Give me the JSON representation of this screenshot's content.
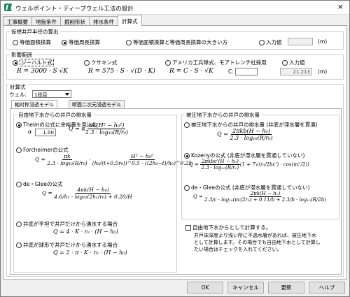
{
  "window": {
    "title": "ウェルポイント・ディープウェル工法の設計",
    "close": "×"
  },
  "tabs": [
    "工事概要",
    "地盤条件",
    "掘削形状",
    "排水条件",
    "計算式"
  ],
  "radius": {
    "title": "仮想井戸半径の算出",
    "opt1": "等価面積換算",
    "opt2": "等価周長換算",
    "opt3": "等価面積換算と等価周長換算の大きい方",
    "opt4": "入力値",
    "unit": "(m)"
  },
  "influence": {
    "title": "影響範囲",
    "opt1": "ジーハルト式",
    "opt2": "クサキン式",
    "opt3": "アメリカ工兵隊式、モアトレンチ社採用",
    "opt4": "入力値",
    "f1": "R = 3000 · S √K",
    "f2": "R = 575 · S · √(D · K)",
    "f3": "R = C · S · √K",
    "c_label": "C:",
    "value": "21.213",
    "unit": "(m)"
  },
  "calc": {
    "title": "計算式",
    "well_label": "ウェル:",
    "well_value": "1段目",
    "sub1": "軸対称浸透モデル",
    "sub2": "断面二次元浸透モデル"
  },
  "free": {
    "title": "自由地下水からの井戸の排水量",
    "thiem": "Theimの公式に余裕量を見込む",
    "alpha": "α",
    "alpha_val": "1.00",
    "forch": "Forcheimerの公式",
    "degl": "de・Gleeの公式",
    "plane": "井底が平坦で井戸だけから湧水する場合",
    "hemi": "井底が球形で井戸だけから湧水する場合",
    "eq_plane": "Q = 4 · K · r₀ · (H − h₀)",
    "eq_hemi": "Q = 2 · π · K · r₀ · (H − h₀)"
  },
  "conf": {
    "title": "被圧地下水からの井戸の排水量",
    "opt1": "被圧地下水からの井戸の排水量 (井底が滞水層を貫通)",
    "opt2": "Kozenyの公式 (井底が滞水層を貫通していない)",
    "opt3": "de・Gleeの公式 (井底が滞水層を貫通していない)"
  },
  "free_check": {
    "label": "自由地下水からとして計算する。",
    "note1": "井戸床深度より浅い所に不透水層があれば、被圧地下水",
    "note2": "として計算します。その場合でも自由地下水として計算し",
    "note3": "たい場合はチェックを入れてください。"
  },
  "buttons": {
    "ok": "OK",
    "cancel": "キャンセル",
    "update": "更新",
    "help": "ヘルプ"
  }
}
